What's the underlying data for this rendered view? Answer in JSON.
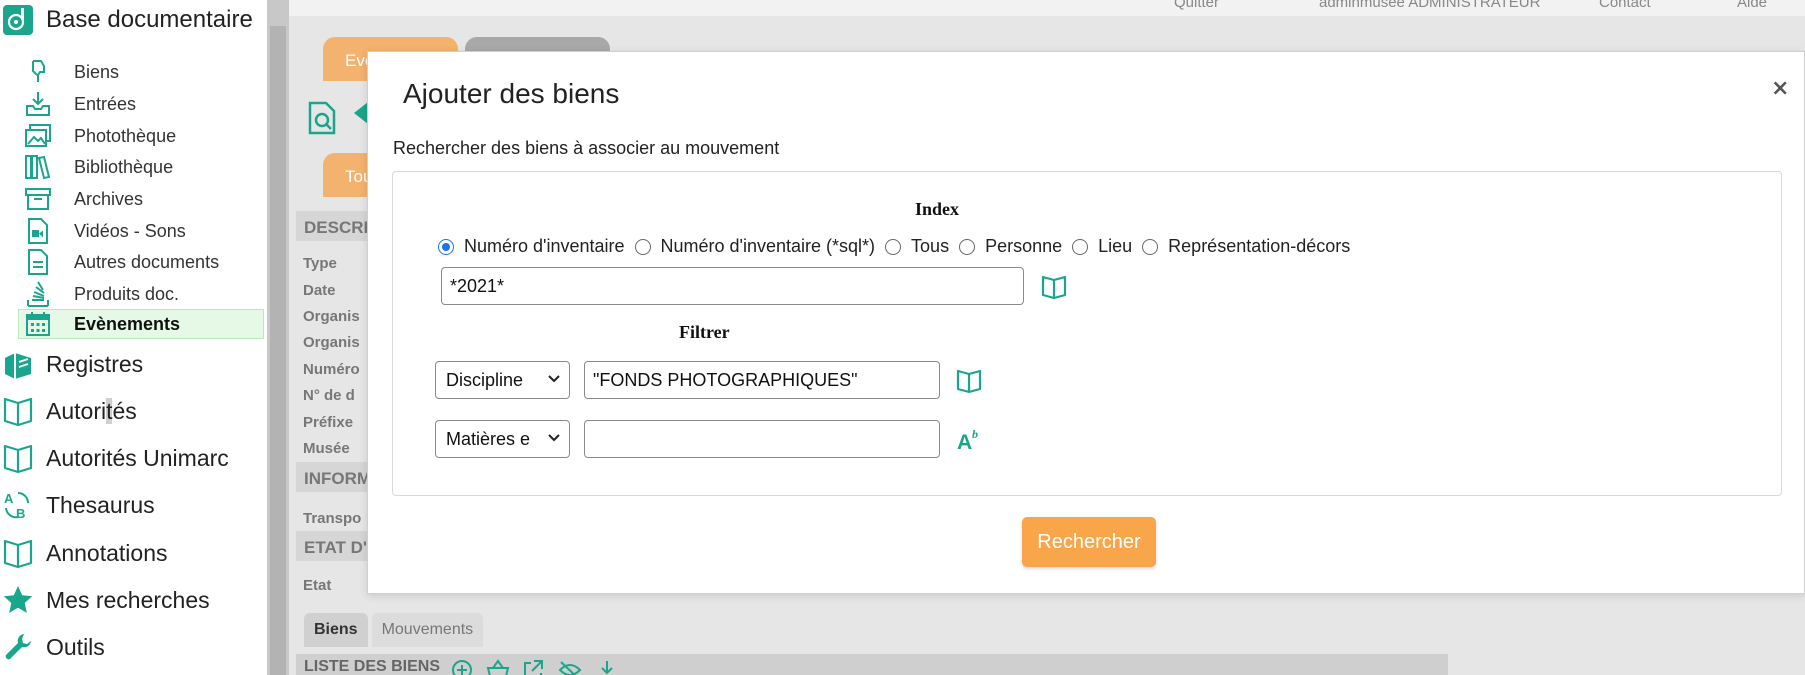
{
  "colors": {
    "accent": "#1aa68c",
    "orange": "#f9a64a",
    "tab_grey": "#a8a8a8"
  },
  "sidebar": {
    "title": "Base documentaire",
    "sub_items": [
      {
        "label": "Biens",
        "icon": "hand-object-icon"
      },
      {
        "label": "Entrées",
        "icon": "inbox-download-icon"
      },
      {
        "label": "Photothèque",
        "icon": "images-icon"
      },
      {
        "label": "Bibliothèque",
        "icon": "books-icon"
      },
      {
        "label": "Archives",
        "icon": "archive-box-icon"
      },
      {
        "label": "Vidéos - Sons",
        "icon": "video-file-icon"
      },
      {
        "label": "Autres documents",
        "icon": "document-icon"
      },
      {
        "label": "Produits doc.",
        "icon": "stack-icon"
      },
      {
        "label": "Evènements",
        "icon": "calendar-icon"
      }
    ],
    "main_items": [
      {
        "label": "Registres",
        "icon": "registers-icon"
      },
      {
        "label_a": "Autori",
        "label_b": "t",
        "label_c": "és",
        "icon": "open-book-icon"
      },
      {
        "label": "Autorités Unimarc",
        "icon": "open-book-icon"
      },
      {
        "label": "Thesaurus",
        "icon": "thesaurus-icon"
      },
      {
        "label": "Annotations",
        "icon": "open-book-icon"
      },
      {
        "label": "Mes recherches",
        "icon": "star-icon"
      },
      {
        "label": "Outils",
        "icon": "wrench-icon"
      }
    ]
  },
  "background": {
    "topbar": {
      "quit": "Quitter",
      "user": "adminmusee ADMINISTRATEUR",
      "contact": "Contact",
      "help": "Aide"
    },
    "tab_event": "Eve",
    "tab_all": "Tou",
    "section_desc": "DESCRI",
    "labels": [
      "Type",
      "Date",
      "Organis",
      "Organis",
      "Numéro",
      "N° de d",
      "Préfixe",
      "Musée"
    ],
    "section_info": "INFORM",
    "label_transport": "Transpo",
    "section_state": "ETAT D'",
    "label_state": "Etat",
    "bottom_tabs": [
      "Biens",
      "Mouvements"
    ],
    "list_title": "LISTE DES BIENS"
  },
  "modal": {
    "title": "Ajouter des biens",
    "close": "×",
    "subtitle": "Rechercher des biens à associer au mouvement",
    "index_heading": "Index",
    "radio_options": [
      {
        "label": "Numéro d'inventaire",
        "checked": true
      },
      {
        "label": "Numéro d'inventaire (*sql*)",
        "checked": false
      },
      {
        "label": "Tous",
        "checked": false
      },
      {
        "label": "Personne",
        "checked": false
      },
      {
        "label": "Lieu",
        "checked": false
      },
      {
        "label": "Représentation-décors",
        "checked": false
      }
    ],
    "index_value": "*2021*",
    "filter_heading": "Filtrer",
    "filters": [
      {
        "field": "Discipline",
        "value": "\"FONDS PHOTOGRAPHIQUES\"",
        "tool_icon": "open-book-icon"
      },
      {
        "field": "Matières e",
        "value": "",
        "tool_icon": "text-format-icon"
      }
    ],
    "search_button": "Rechercher"
  }
}
